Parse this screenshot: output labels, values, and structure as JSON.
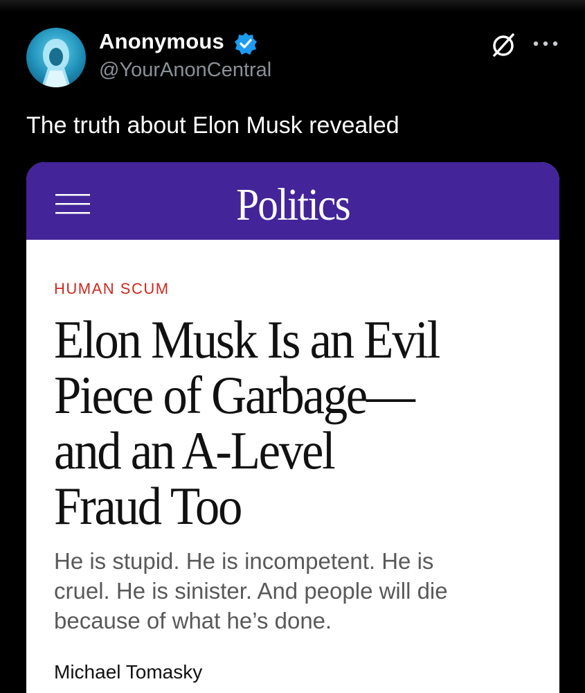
{
  "post": {
    "author": {
      "name": "Anonymous",
      "handle": "@YourAnonCentral",
      "verified": true,
      "avatar_icon": "hooded-figure-avatar"
    },
    "text": "The truth about Elon Musk revealed",
    "actions": {
      "grok_icon": "grok-icon",
      "more_icon": "more-options-icon"
    }
  },
  "article_card": {
    "header": {
      "menu_icon": "hamburger-menu-icon",
      "section": "Politics",
      "background_color": "#432499"
    },
    "kicker": "HUMAN SCUM",
    "kicker_color": "#d0281f",
    "headline_lines": [
      "Elon Musk Is an Evil",
      "Piece of Garbage—",
      "and an A-Level",
      "Fraud Too"
    ],
    "dek_lines": [
      "He is stupid. He is incompetent. He is",
      "cruel. He is sinister. And people will die",
      "because of what he’s done."
    ],
    "byline": "Michael Tomasky"
  },
  "colors": {
    "background": "#000000",
    "handle_text": "#8b9198",
    "verified_badge": "#1d9bf0"
  }
}
